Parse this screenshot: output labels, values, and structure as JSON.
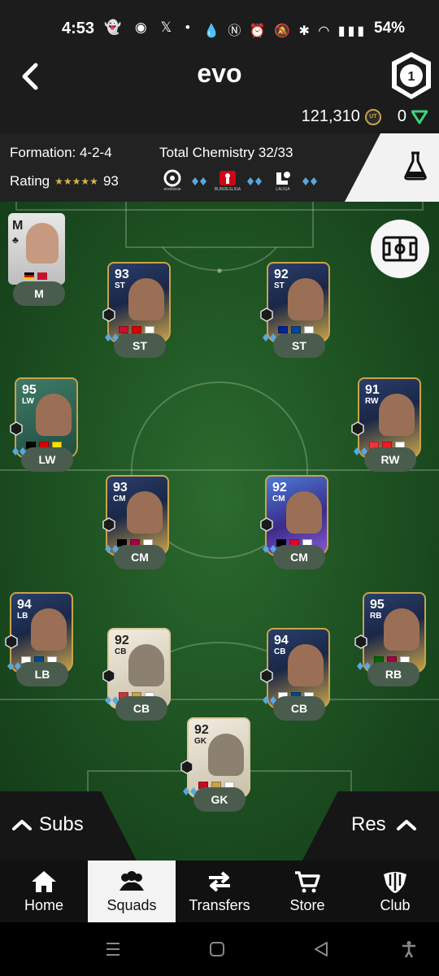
{
  "status_bar": {
    "time": "4:53",
    "battery": "54%",
    "left_icons": [
      "snapchat-icon",
      "discord-icon",
      "x-icon",
      "dot-icon"
    ],
    "right_icons": [
      "data-saver-icon",
      "nfc-icon",
      "alarm-icon",
      "mute-icon",
      "bluetooth-icon",
      "wifi-icon",
      "volte-icon",
      "signal-icon",
      "battery-icon"
    ]
  },
  "header": {
    "title": "evo",
    "coins": "121,310",
    "points": "0",
    "coin_symbol": "UT"
  },
  "info": {
    "formation": "Formation: 4-2-4",
    "chemistry": "Total Chemistry 32/33",
    "rating_label": "Rating",
    "stars": "★★★★★",
    "rating": "93",
    "leagues": [
      {
        "name": "eredivisie"
      },
      {
        "name": "BUNDESLIGA"
      },
      {
        "name": "LALIGA"
      }
    ]
  },
  "manager": {
    "label": "M",
    "position": "M"
  },
  "players": [
    {
      "id": "st-left",
      "rating": "93",
      "pos": "ST",
      "slot": "ST",
      "flags": [
        "#c8102e",
        "#dd0000",
        "#ffffff"
      ],
      "card": "tots"
    },
    {
      "id": "st-right",
      "rating": "92",
      "pos": "ST",
      "slot": "ST",
      "flags": [
        "#002395",
        "#034694",
        "#ffffff"
      ],
      "card": "tots"
    },
    {
      "id": "lw",
      "rating": "95",
      "pos": "LW",
      "slot": "LW",
      "flags": [
        "#000000",
        "#dd0000",
        "#fde100"
      ],
      "card": "evo"
    },
    {
      "id": "rw",
      "rating": "91",
      "pos": "RW",
      "slot": "RW",
      "flags": [
        "#ef3340",
        "#ed1c24",
        "#ffffff"
      ],
      "card": "tots"
    },
    {
      "id": "cm-left",
      "rating": "93",
      "pos": "CM",
      "slot": "CM",
      "flags": [
        "#000000",
        "#a50044",
        "#ffffff"
      ],
      "card": "tots"
    },
    {
      "id": "cm-right",
      "rating": "92",
      "pos": "CM",
      "slot": "CM",
      "flags": [
        "#000000",
        "#dc052d",
        "#ffffff"
      ],
      "card": "ucl"
    },
    {
      "id": "lb",
      "rating": "94",
      "pos": "LB",
      "slot": "LB",
      "flags": [
        "#ffffff",
        "#034694",
        "#ffffff"
      ],
      "card": "tots"
    },
    {
      "id": "cb-left",
      "rating": "92",
      "pos": "CB",
      "slot": "CB",
      "flags": [
        "#c6363c",
        "#c9a34a",
        "#ffffff"
      ],
      "card": "icon"
    },
    {
      "id": "cb-right",
      "rating": "94",
      "pos": "CB",
      "slot": "CB",
      "flags": [
        "#ffffff",
        "#034694",
        "#ffffff"
      ],
      "card": "tots"
    },
    {
      "id": "rb",
      "rating": "95",
      "pos": "RB",
      "slot": "RB",
      "flags": [
        "#006600",
        "#a50044",
        "#ffffff"
      ],
      "card": "tots"
    },
    {
      "id": "gk",
      "rating": "92",
      "pos": "GK",
      "slot": "GK",
      "flags": [
        "#c60b1e",
        "#c9a34a",
        "#ffffff"
      ],
      "card": "icon"
    }
  ],
  "bottom": {
    "subs": "Subs",
    "res": "Res"
  },
  "nav": [
    {
      "label": "Home",
      "icon": "home-icon"
    },
    {
      "label": "Squads",
      "icon": "squads-icon"
    },
    {
      "label": "Transfers",
      "icon": "transfers-icon"
    },
    {
      "label": "Store",
      "icon": "store-icon"
    },
    {
      "label": "Club",
      "icon": "club-icon"
    }
  ],
  "colors": {
    "accent": "#d9b44a",
    "pitch": "#1f5423",
    "header": "#1c1c1c"
  }
}
